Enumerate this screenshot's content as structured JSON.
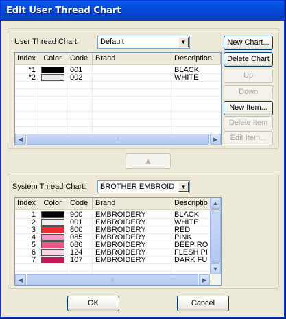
{
  "window": {
    "title": "Edit User Thread Chart"
  },
  "user_section": {
    "label": "User Thread Chart:",
    "chart_select": "Default",
    "columns": [
      "Index",
      "Color",
      "Code",
      "Brand",
      "Description"
    ],
    "rows": [
      {
        "index": "*1",
        "color": "#000000",
        "code": "001",
        "brand": "",
        "description": "BLACK"
      },
      {
        "index": "*2",
        "color": "#ececec",
        "code": "002",
        "brand": "",
        "description": "WHITE"
      }
    ],
    "buttons": {
      "new_chart": "New Chart...",
      "delete_chart": "Delete Chart",
      "up": "Up",
      "down": "Down",
      "new_item": "New Item...",
      "delete_item": "Delete Item",
      "edit_item": "Edit Item..."
    }
  },
  "system_section": {
    "label": "System Thread Chart:",
    "chart_select": "BROTHER EMBROID",
    "columns": [
      "Index",
      "Color",
      "Code",
      "Brand",
      "Descriptio"
    ],
    "rows": [
      {
        "index": "1",
        "color": "#000000",
        "code": "900",
        "brand": "EMBROIDERY",
        "description": "BLACK"
      },
      {
        "index": "2",
        "color": "#f0f0f0",
        "code": "001",
        "brand": "EMBROIDERY",
        "description": "WHITE"
      },
      {
        "index": "3",
        "color": "#ee2a34",
        "code": "800",
        "brand": "EMBROIDERY",
        "description": "RED"
      },
      {
        "index": "4",
        "color": "#f59ac0",
        "code": "085",
        "brand": "EMBROIDERY",
        "description": "PINK"
      },
      {
        "index": "5",
        "color": "#f0528a",
        "code": "086",
        "brand": "EMBROIDERY",
        "description": "DEEP RO"
      },
      {
        "index": "6",
        "color": "#fbd5e1",
        "code": "124",
        "brand": "EMBROIDERY",
        "description": "FLESH PI"
      },
      {
        "index": "7",
        "color": "#c8175a",
        "code": "107",
        "brand": "EMBROIDERY",
        "description": "DARK FU"
      }
    ]
  },
  "buttons": {
    "ok": "OK",
    "cancel": "Cancel"
  }
}
